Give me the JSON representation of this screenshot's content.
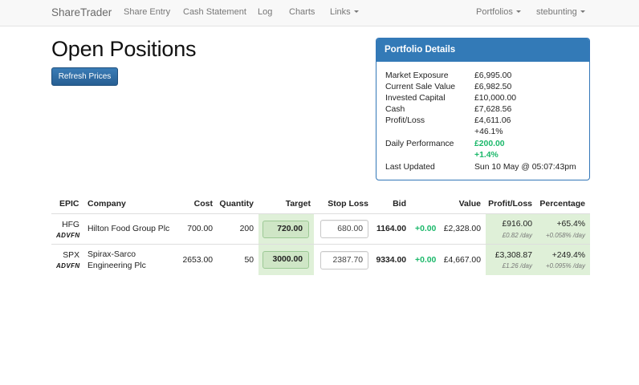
{
  "nav": {
    "brand": "ShareTrader",
    "links": [
      "Share Entry",
      "Cash Statement",
      "Log",
      "Charts",
      "Links"
    ],
    "portfolios": "Portfolios",
    "user": "stebunting"
  },
  "page": {
    "title": "Open Positions",
    "refresh_label": "Refresh Prices"
  },
  "portfolio": {
    "heading": "Portfolio Details",
    "market_exposure_label": "Market Exposure",
    "market_exposure": "£6,995.00",
    "current_sale_value_label": "Current Sale Value",
    "current_sale_value": "£6,982.50",
    "invested_capital_label": "Invested Capital",
    "invested_capital": "£10,000.00",
    "cash_label": "Cash",
    "cash": "£7,628.56",
    "profit_loss_label": "Profit/Loss",
    "profit_loss": "£4,611.06",
    "profit_loss_pct": "+46.1%",
    "daily_performance_label": "Daily Performance",
    "daily_performance": "£200.00",
    "daily_performance_pct": "+1.4%",
    "last_updated_label": "Last Updated",
    "last_updated": "Sun 10 May @ 05:07:43pm"
  },
  "table": {
    "headers": {
      "epic": "EPIC",
      "company": "Company",
      "cost": "Cost",
      "quantity": "Quantity",
      "target": "Target",
      "stop_loss": "Stop Loss",
      "bid": "Bid",
      "value": "Value",
      "profit_loss": "Profit/Loss",
      "percentage": "Percentage"
    },
    "rows": [
      {
        "epic": "HFG",
        "advfn": "ADVFN",
        "company_line1": "Hilton Food Group Plc",
        "company_line2": "",
        "cost": "700.00",
        "quantity": "200",
        "target": "720.00",
        "stop_loss": "680.00",
        "bid": "1164.00",
        "change": "+0.00",
        "value": "£2,328.00",
        "profit_loss": "£916.00",
        "profit_loss_day": "£0.82 /day",
        "percentage": "+65.4%",
        "percentage_day": "+0.058% /day"
      },
      {
        "epic": "SPX",
        "advfn": "ADVFN",
        "company_line1": "Spirax-Sarco",
        "company_line2": "Engineering Plc",
        "cost": "2653.00",
        "quantity": "50",
        "target": "3000.00",
        "stop_loss": "2387.70",
        "bid": "9334.00",
        "change": "+0.00",
        "value": "£4,667.00",
        "profit_loss": "£3,308.87",
        "profit_loss_day": "£1.26 /day",
        "percentage": "+249.4%",
        "percentage_day": "+0.095% /day"
      }
    ]
  },
  "colors": {
    "primary": "#337ab7",
    "success_text": "#1bb86a",
    "success_bg": "#dff0d8"
  }
}
